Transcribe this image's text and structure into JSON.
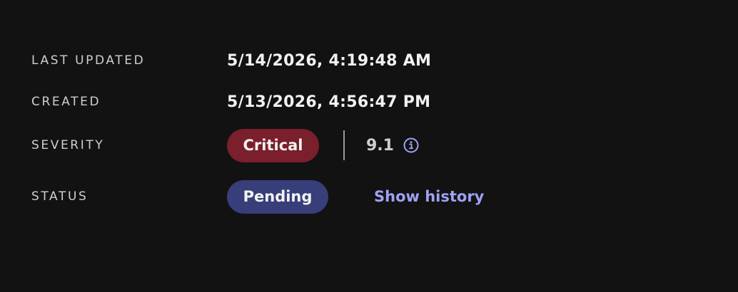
{
  "details": {
    "last_updated": {
      "label": "LAST UPDATED",
      "value": "5/14/2026, 4:19:48 AM"
    },
    "created": {
      "label": "CREATED",
      "value": "5/13/2026, 4:56:47 PM"
    },
    "severity": {
      "label": "SEVERITY",
      "badge": "Critical",
      "badge_color": "#7a1f2b",
      "score": "9.1",
      "info_icon": "info-circle-icon",
      "info_icon_color": "#9ea2f5"
    },
    "status": {
      "label": "STATUS",
      "badge": "Pending",
      "badge_color": "#373e79",
      "history_link": "Show history",
      "link_color": "#9ea2f5"
    }
  },
  "colors": {
    "background": "#121212",
    "label_text": "#cfcfcf",
    "value_text": "#f2f2f2"
  }
}
